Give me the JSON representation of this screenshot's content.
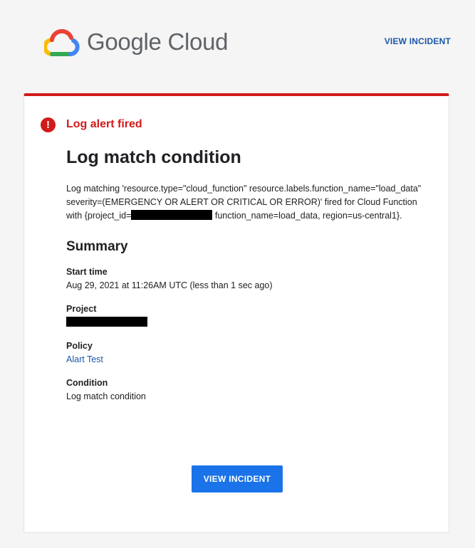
{
  "header": {
    "logo_text": "Google Cloud",
    "view_incident_link": "VIEW INCIDENT"
  },
  "alert": {
    "icon": "exclamation-circle-icon",
    "label": "Log alert fired",
    "color": "#d21a1a"
  },
  "main": {
    "title": "Log match condition",
    "description_part1": "Log matching 'resource.type=\"cloud_function\" resource.labels.function_name=\"load_data\" severity=(EMERGENCY OR ALERT OR CRITICAL OR ERROR)' fired for Cloud Function with {project_id=",
    "description_part2": " function_name=load_data, region=us-central1}."
  },
  "summary": {
    "heading": "Summary",
    "start_time_label": "Start time",
    "start_time_value": "Aug 29, 2021 at 11:26AM UTC (less than 1 sec ago)",
    "project_label": "Project",
    "policy_label": "Policy",
    "policy_value": "Alart Test",
    "condition_label": "Condition",
    "condition_value": "Log match condition"
  },
  "footer": {
    "button_label": "VIEW INCIDENT",
    "button_color": "#1a73e8"
  }
}
